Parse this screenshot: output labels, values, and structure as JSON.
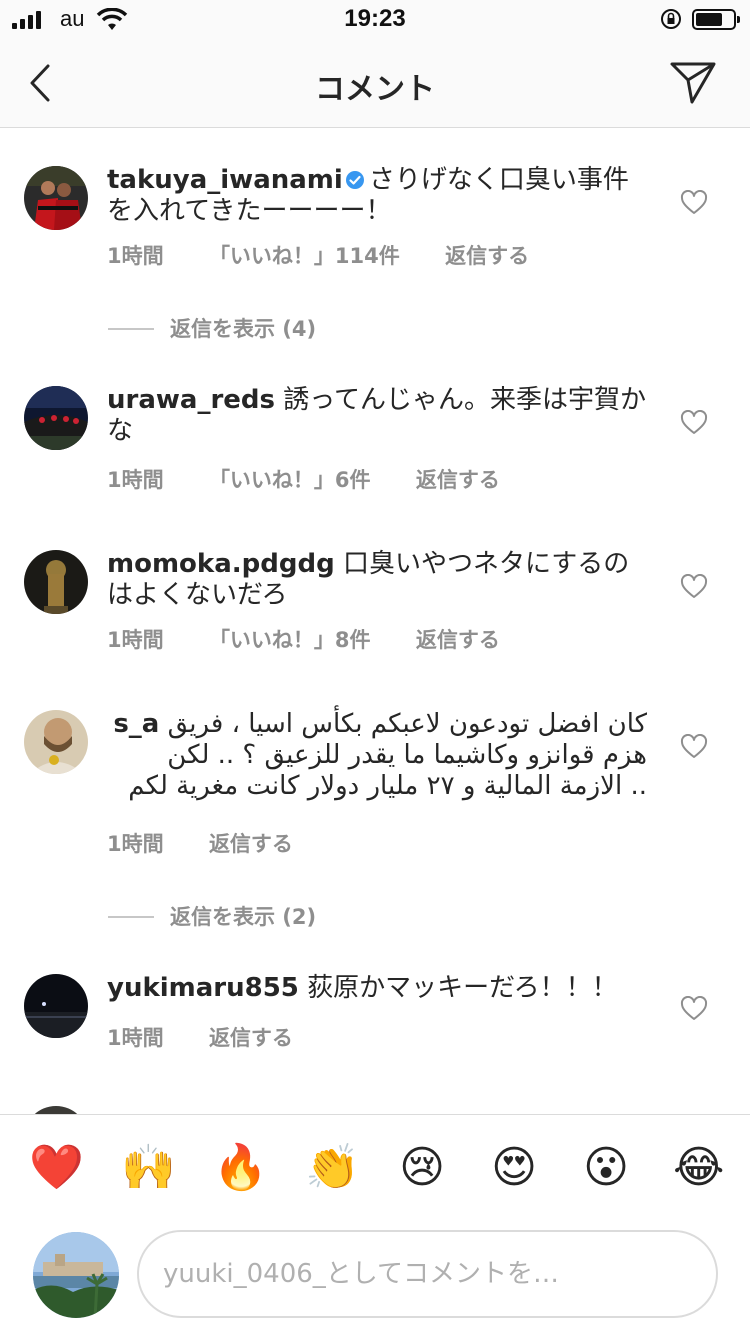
{
  "status_bar": {
    "carrier": "au",
    "time": "19:23"
  },
  "header": {
    "title": "コメント"
  },
  "comments": [
    {
      "username": "takuya_iwanami",
      "verified": true,
      "text": "さりげなく口臭い事件を入れてきたーーーー！",
      "time": "1時間",
      "likes": "「いいね！」114件",
      "reply": "返信する",
      "view_replies": "返信を表示 (4)"
    },
    {
      "username": "urawa_reds",
      "text": "誘ってんじゃん。来季は宇賀かな",
      "time": "1時間",
      "likes": "「いいね！」6件",
      "reply": "返信する"
    },
    {
      "username": "momoka.pdgdg",
      "text": "口臭いやつネタにするのはよくないだろ",
      "time": "1時間",
      "likes": "「いいね！」8件",
      "reply": "返信する"
    },
    {
      "username": "s_a",
      "text": "كان افضل تودعون لاعبكم بكأس اسيا ، فريق هزم قوانزو وكاشيما ما يقدر للزعيق ؟ .. لكن الازمة المالية و ٢٧ مليار دولار كانت مغرية لكم ..",
      "time": "1時間",
      "reply": "返信する",
      "view_replies": "返信を表示 (2)"
    },
    {
      "username": "yukimaru855",
      "text": "荻原かマッキーだろ！！！",
      "time": "1時間",
      "reply": "返信する"
    }
  ],
  "emojis": [
    "❤️",
    "🙌",
    "🔥",
    "👏",
    "😢",
    "😍",
    "😮",
    "😂"
  ],
  "composer": {
    "placeholder": "yuuki_0406_としてコメントを…"
  },
  "colors": {
    "text": "#262626",
    "secondary": "#8e8e8e",
    "verified_blue": "#3897f0",
    "border": "#dbdbdb"
  }
}
